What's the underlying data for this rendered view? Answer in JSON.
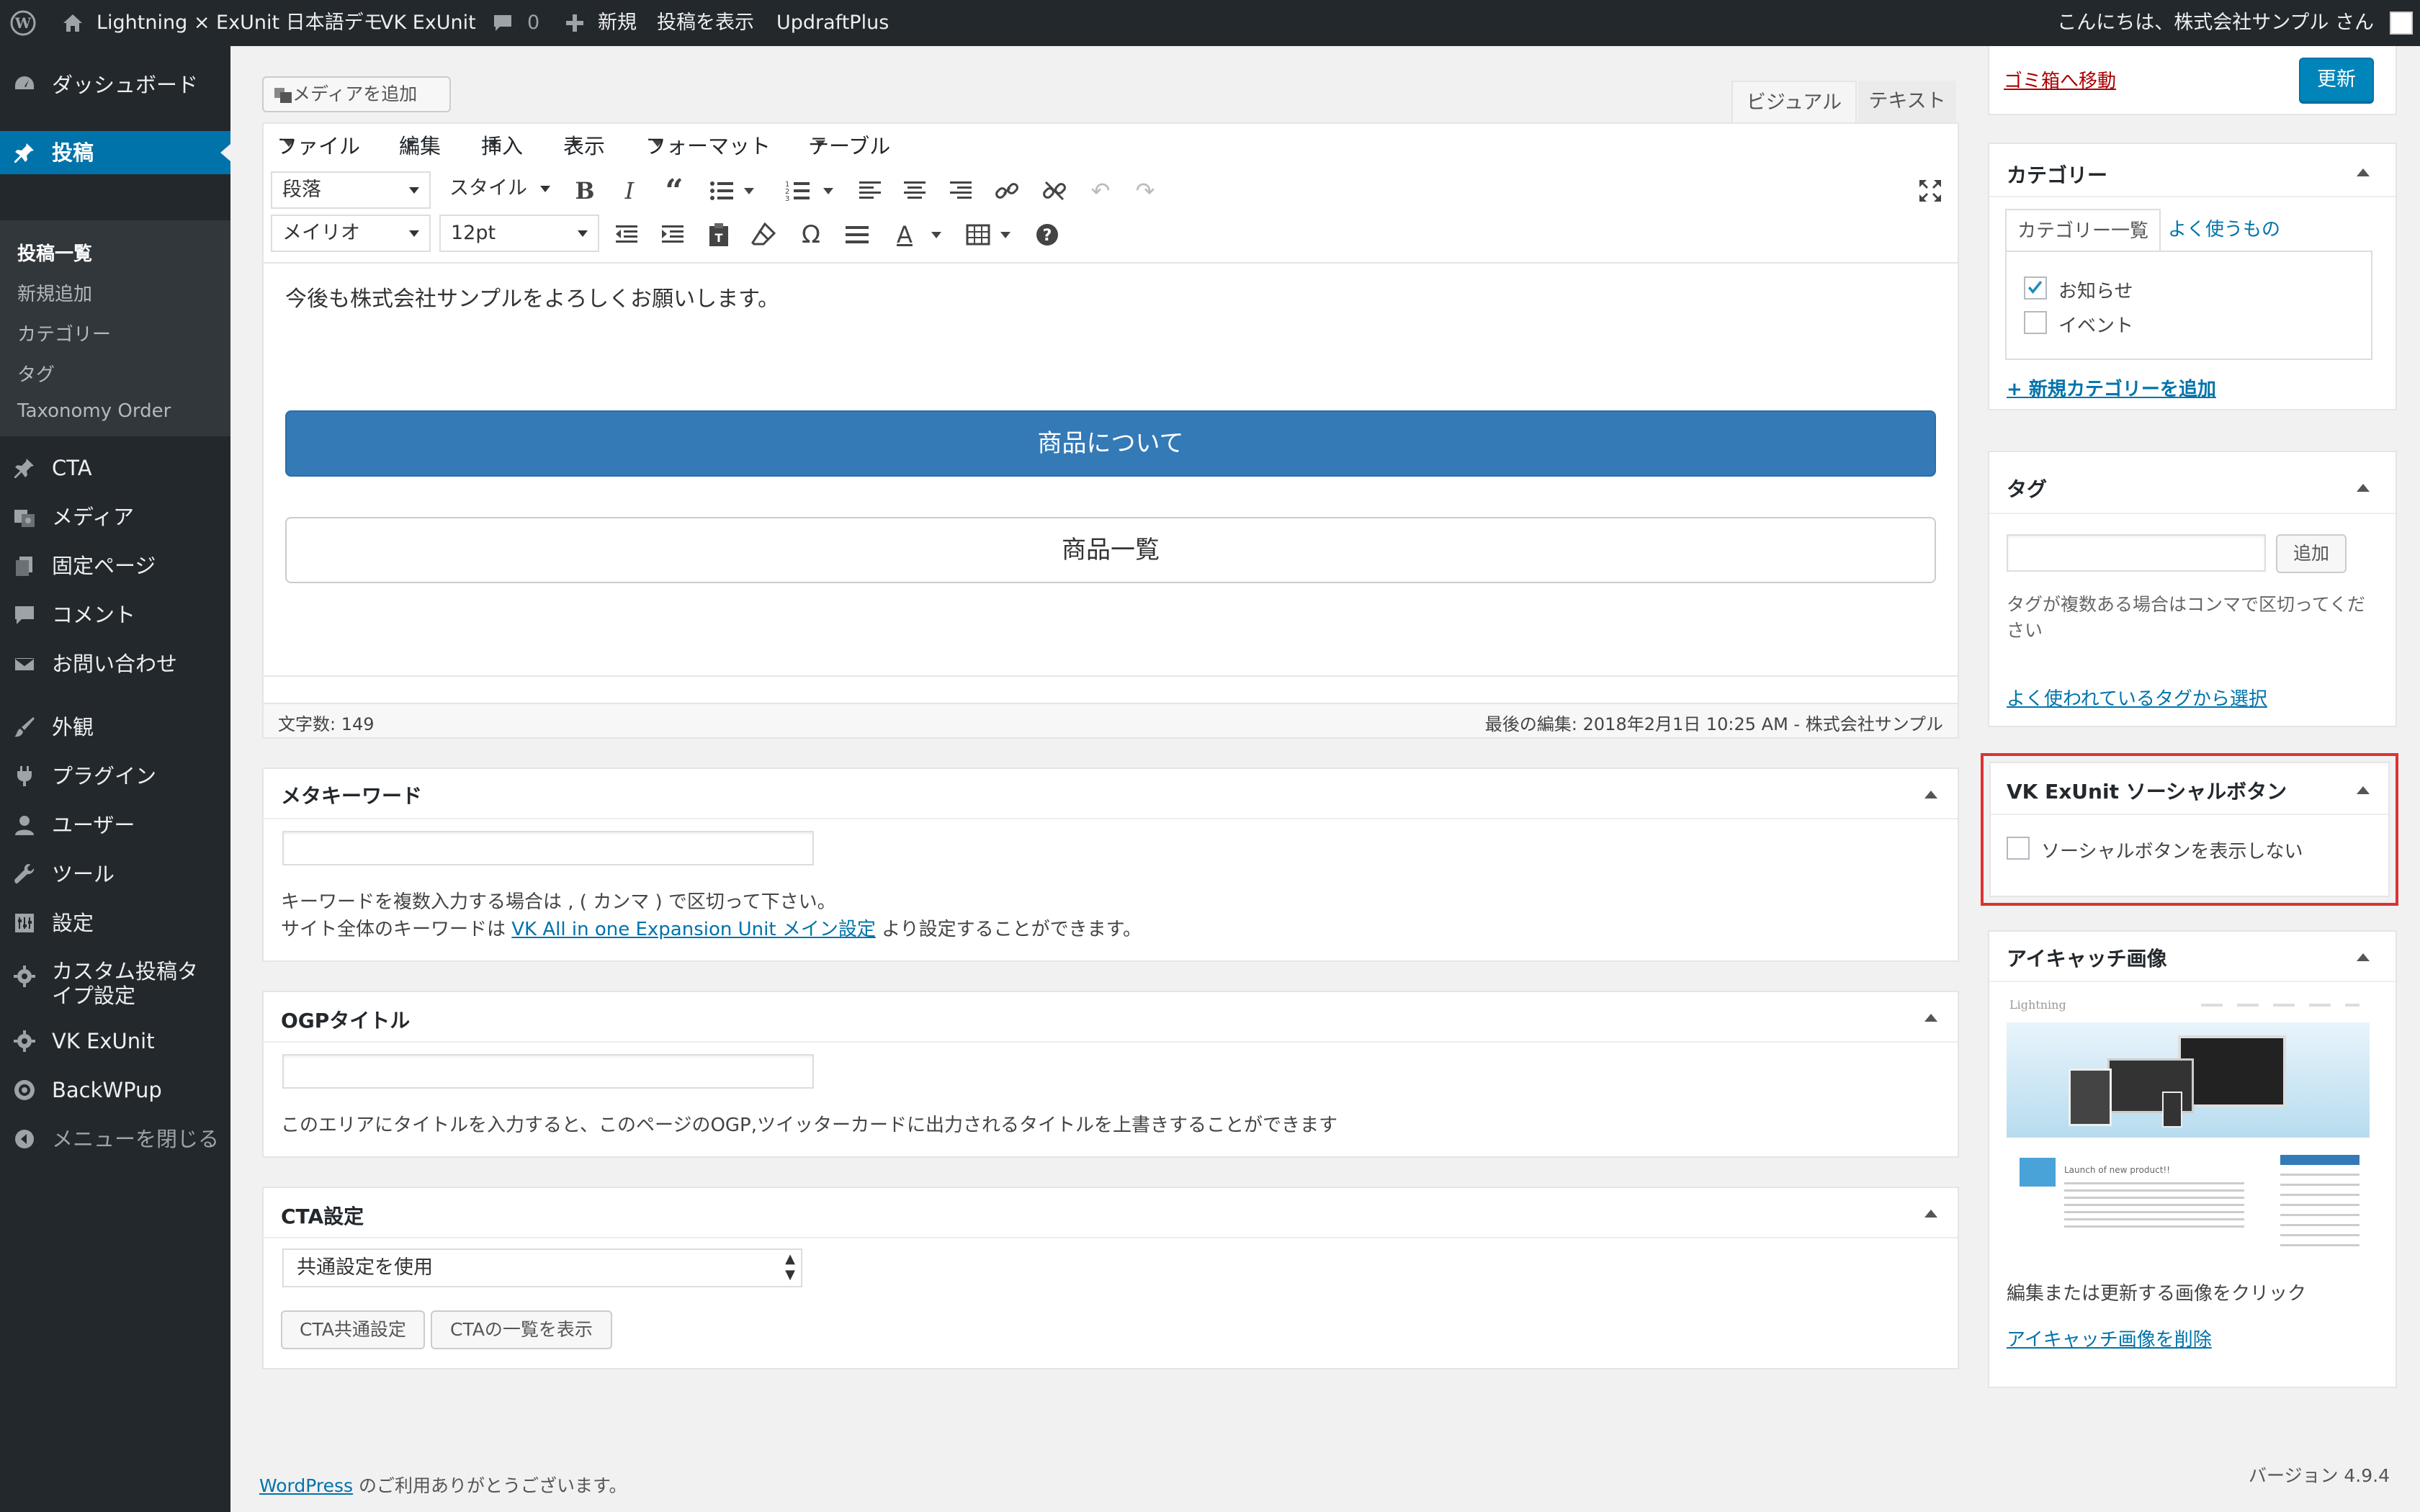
{
  "topbar": {
    "site_name": "Lightning × ExUnit 日本語デモ",
    "vk_exunit": "VK ExUnit",
    "comments_count": "0",
    "new": "新規",
    "view_post": "投稿を表示",
    "updraft": "UpdraftPlus",
    "greeting": "こんにちは、株式会社サンプル さん"
  },
  "menu": {
    "dashboard": "ダッシュボード",
    "posts": "投稿",
    "sub": [
      "投稿一覧",
      "新規追加",
      "カテゴリー",
      "タグ",
      "Taxonomy Order"
    ],
    "cta": "CTA",
    "media": "メディア",
    "pages": "固定ページ",
    "comments": "コメント",
    "contact": "お問い合わせ",
    "appearance": "外観",
    "plugins": "プラグイン",
    "users": "ユーザー",
    "tools": "ツール",
    "settings": "設定",
    "cpt": "カスタム投稿タイプ設定",
    "vk_exunit": "VK ExUnit",
    "backwpup": "BackWPup",
    "collapse": "メニューを閉じる"
  },
  "editor": {
    "add_media": "メディアを追加",
    "tab_visual": "ビジュアル",
    "tab_text": "テキスト",
    "menus": [
      "ファイル",
      "編集",
      "挿入",
      "表示",
      "フォーマット",
      "テーブル"
    ],
    "format": "段落",
    "style": "スタイル",
    "font": "メイリオ",
    "size": "12pt",
    "content_text": "今後も株式会社サンプルをよろしくお願いします。",
    "btn_primary": "商品について",
    "btn_secondary": "商品一覧",
    "word_count": "文字数: 149",
    "last_edit": "最後の編集: 2018年2月1日 10:25 AM - 株式会社サンプル"
  },
  "meta_keywords": {
    "title": "メタキーワード",
    "help1": "キーワードを複数入力する場合は , ( カンマ ) で区切って下さい。",
    "help2_pre": "サイト全体のキーワードは ",
    "help2_link": "VK All in one Expansion Unit メイン設定",
    "help2_post": " より設定することができます。"
  },
  "ogp": {
    "title": "OGPタイトル",
    "help": "このエリアにタイトルを入力すると、このページのOGP,ツイッターカードに出力されるタイトルを上書きすることができます"
  },
  "cta": {
    "title": "CTA設定",
    "select": "共通設定を使用",
    "btn_common": "CTA共通設定",
    "btn_list": "CTAの一覧を表示"
  },
  "publish": {
    "trash": "ゴミ箱へ移動",
    "update": "更新"
  },
  "categories": {
    "title": "カテゴリー",
    "tab_all": "カテゴリー一覧",
    "tab_popular": "よく使うもの",
    "items": [
      {
        "label": "お知らせ",
        "checked": true
      },
      {
        "label": "イベント",
        "checked": false
      }
    ],
    "add_new": "+ 新規カテゴリーを追加"
  },
  "tags": {
    "title": "タグ",
    "add": "追加",
    "help": "タグが複数ある場合はコンマで区切ってください",
    "choose": "よく使われているタグから選択"
  },
  "social": {
    "title": "VK ExUnit ソーシャルボタン",
    "hide_label": "ソーシャルボタンを表示しない",
    "highlight_color": "#dc3232"
  },
  "featured": {
    "title": "アイキャッチ画像",
    "thumb_logo": "Lightning",
    "thumb_post": "Launch of new product!!",
    "help": "編集または更新する画像をクリック",
    "remove": "アイキャッチ画像を削除"
  },
  "footer": {
    "wp": "WordPress",
    "thanks": " のご利用ありがとうございます。",
    "version": "バージョン 4.9.4"
  },
  "colors": {
    "admin_bar": "#23282d",
    "accent": "#0073aa",
    "primary_button": "#337ab7"
  }
}
